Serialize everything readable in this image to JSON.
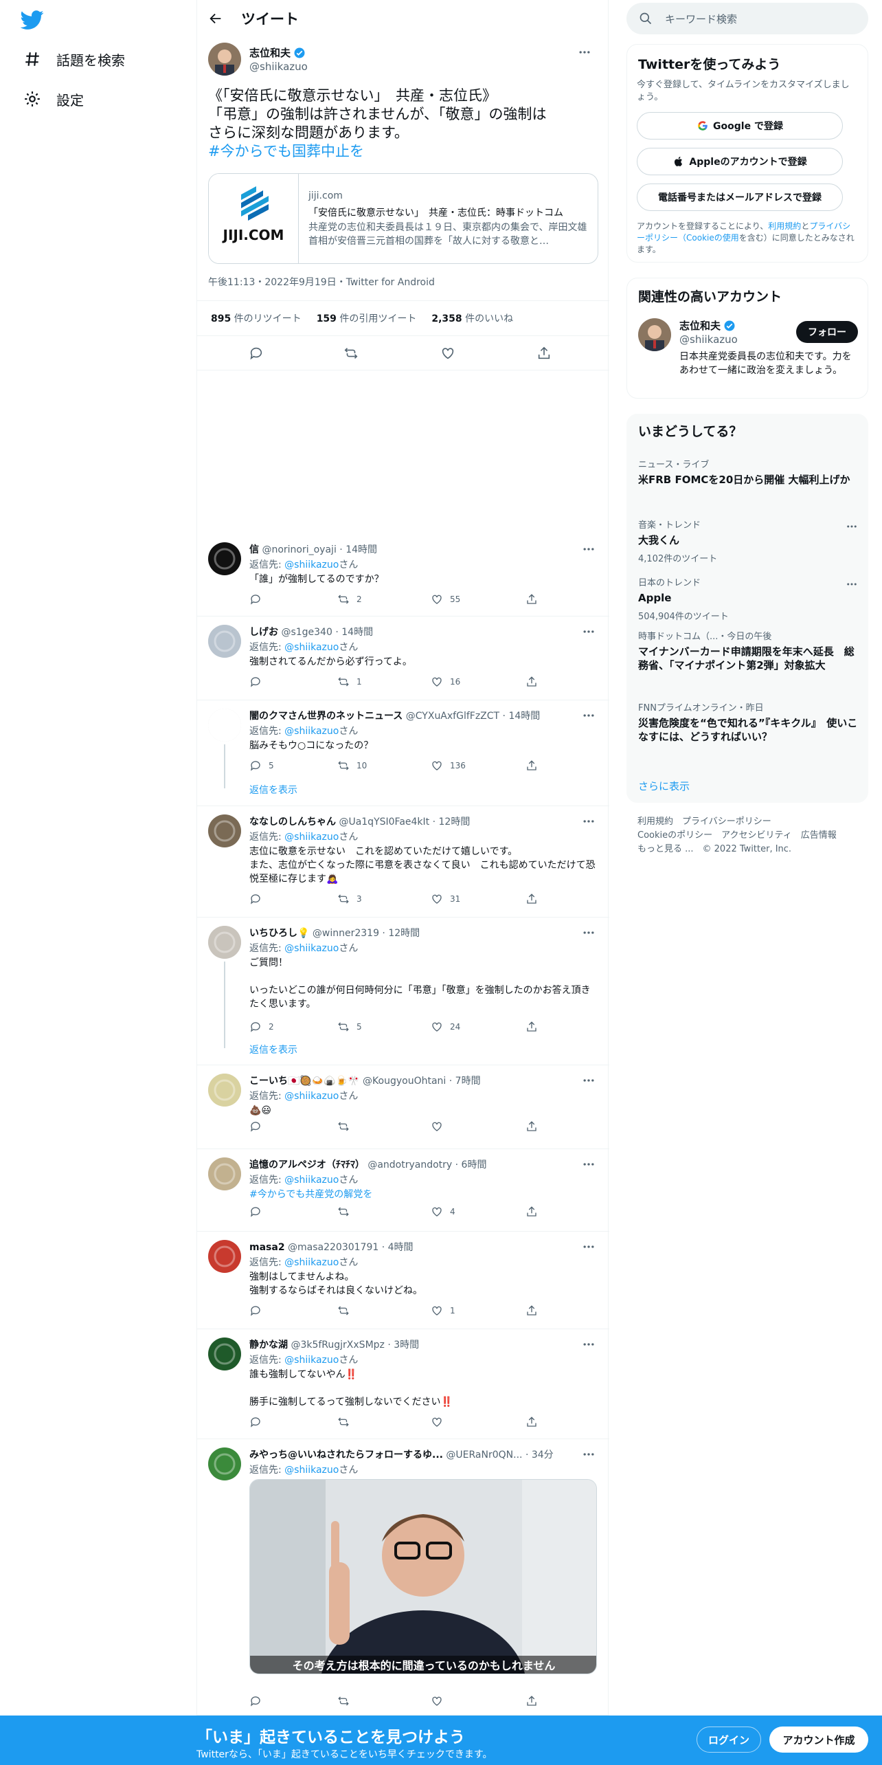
{
  "nav": {
    "explore": "話題を検索",
    "settings": "設定"
  },
  "header": {
    "title": "ツイート"
  },
  "tweet": {
    "name": "志位和夫",
    "handle": "@shiikazuo",
    "line1": "《「安倍氏に敬意示せない」　共産・志位氏》",
    "line2": "「弔意」の強制は許されませんが、「敬意」の強制は",
    "line3": "さらに深刻な問題があります。",
    "hashtag": "#今からでも国葬中止を",
    "card": {
      "logo_text": "JIJI.COM",
      "domain": "jiji.com",
      "title": "「安倍氏に敬意示せない」　共産・志位氏：時事ドットコム",
      "desc": "共産党の志位和夫委員長は１９日、東京都内の集会で、岸田文雄首相が安倍晋三元首相の国葬を「故人に対する敬意と…"
    },
    "meta": "午後11:13・2022年9月19日・Twitter for Android",
    "retweets_num": "895",
    "retweets_label": " 件のリツイート",
    "quotes_num": "159",
    "quotes_label": " 件の引用ツイート",
    "likes_num": "2,358",
    "likes_label": " 件のいいね"
  },
  "replying_to_label": "返信先: ",
  "replying_to_handle": "@shiikazuo",
  "replying_to_suffix": "さん",
  "show_replies": "返信を表示",
  "replies": [
    {
      "name": "信",
      "handle": "@norinori_oyaji",
      "time": "14時間",
      "text": "「誰」が強制してるのですか？",
      "replies": "",
      "retweets": "2",
      "likes": "55"
    },
    {
      "name": "しげお",
      "handle": "@s1ge340",
      "time": "14時間",
      "text": "強制されてるんだから必ず行ってよ。",
      "replies": "",
      "retweets": "1",
      "likes": "16"
    },
    {
      "name": "闇のクマさん世界のネットニュース",
      "handle": "@CYXuAxfGlfFzZCT",
      "time": "14時間",
      "text": "脳みそもウ○コになったの？",
      "replies": "5",
      "retweets": "10",
      "likes": "136"
    },
    {
      "name": "ななしのしんちゃん",
      "handle": "@Ua1qYSI0Fae4kIt",
      "time": "12時間",
      "text": "志位に敬意を示せない　これを認めていただけて嬉しいです。\nまた、志位が亡くなった際に弔意を表さなくて良い　これも認めていただけて恐悦至極に存じます🙇‍♀️",
      "replies": "",
      "retweets": "3",
      "likes": "31"
    },
    {
      "name": "いちひろし💡",
      "handle": "@winner2319",
      "time": "12時間",
      "text": "ご質問！\n\nいったいどこの誰が何日何時何分に「弔意」「敬意」を強制したのかお答え頂きたく思います。",
      "replies": "2",
      "retweets": "5",
      "likes": "24"
    },
    {
      "name": "こーいち🇯🇵🥘🍛🍙🍺🎌",
      "handle": "@KougyouOhtani",
      "time": "7時間",
      "text": "💩😃",
      "replies": "",
      "retweets": "",
      "likes": ""
    },
    {
      "name": "追憶のアルペジオ（ﾁﾏﾁﾏ）",
      "handle": "@andotryandotry",
      "time": "6時間",
      "text": "#今からでも共産党の解党を",
      "replies": "",
      "retweets": "",
      "likes": "4"
    },
    {
      "name": "masa2",
      "handle": "@masa220301791",
      "time": "4時間",
      "text": "強制はしてませんよね。\n強制するならばそれは良くないけどね。",
      "replies": "",
      "retweets": "",
      "likes": "1"
    },
    {
      "name": "静かな湖",
      "handle": "@3k5fRugjrXxSMpz",
      "time": "3時間",
      "text": "誰も強制してないやん‼️\n\n勝手に強制してるって強制しないでください‼️",
      "replies": "",
      "retweets": "",
      "likes": ""
    },
    {
      "name": "みやっち@いいねされたらフォローするゆ...",
      "handle": "@UERaNr0QN...",
      "time": "34分",
      "text": "",
      "replies": "",
      "retweets": "",
      "likes": "",
      "media_caption": "その考え方は根本的に間違っているのかもしれません"
    }
  ],
  "sidebar": {
    "search_placeholder": "キーワード検索",
    "signup_panel": {
      "title": "Twitterを使ってみよう",
      "subtitle": "今すぐ登録して、タイムラインをカスタマイズしましょう。",
      "google": "Google で登録",
      "apple": "Appleのアカウントで登録",
      "phone": "電話番号またはメールアドレスで登録",
      "terms_pre": "アカウントを登録することにより、",
      "terms_link1": "利用規約",
      "terms_mid": "と",
      "terms_link2": "プライバシーポリシー（Cookieの使用",
      "terms_post": "を含む）に同意したとみなされます。"
    },
    "related": {
      "title": "関連性の高いアカウント",
      "name": "志位和夫",
      "handle": "@shiikazuo",
      "follow": "フォロー",
      "bio": "日本共産党委員長の志位和夫です。力をあわせて一緒に政治を変えましょう。"
    },
    "trends": {
      "title": "いまどうしてる？",
      "items": [
        {
          "cat": "ニュース・ライブ",
          "title": "米FRB FOMCを20日から開催 大幅利上げか",
          "count": ""
        },
        {
          "cat": "音楽・トレンド",
          "title": "大我くん",
          "count": "4,102件のツイート"
        },
        {
          "cat": "日本のトレンド",
          "title": "Apple",
          "count": "504,904件のツイート"
        },
        {
          "cat": "時事ドットコム（...・今日の午後",
          "title": "マイナンバーカード申請期限を年末へ延長　総務省、「マイナポイント第2弾」対象拡大",
          "count": ""
        },
        {
          "cat": "FNNプライムオンライン・昨日",
          "title": "災害危険度を“色で知れる”『キキクル』　使いこなすには、どうすればいい？",
          "count": ""
        }
      ],
      "more": "さらに表示"
    },
    "footer": {
      "l1": "利用規約　プライバシーポリシー",
      "l2": "Cookieのポリシー　アクセシビリティ　広告情報",
      "l3": "もっと見る ...　© 2022 Twitter, Inc."
    }
  },
  "banner": {
    "headline": "「いま」起きていることを見つけよう",
    "sub": "Twitterなら、「いま」起きていることをいち早くチェックできます。",
    "login": "ログイン",
    "signup": "アカウント作成"
  },
  "colors": {
    "accent": "#1d9bf0",
    "text": "#0f1419",
    "muted": "#536471",
    "border": "#eff3f4"
  }
}
